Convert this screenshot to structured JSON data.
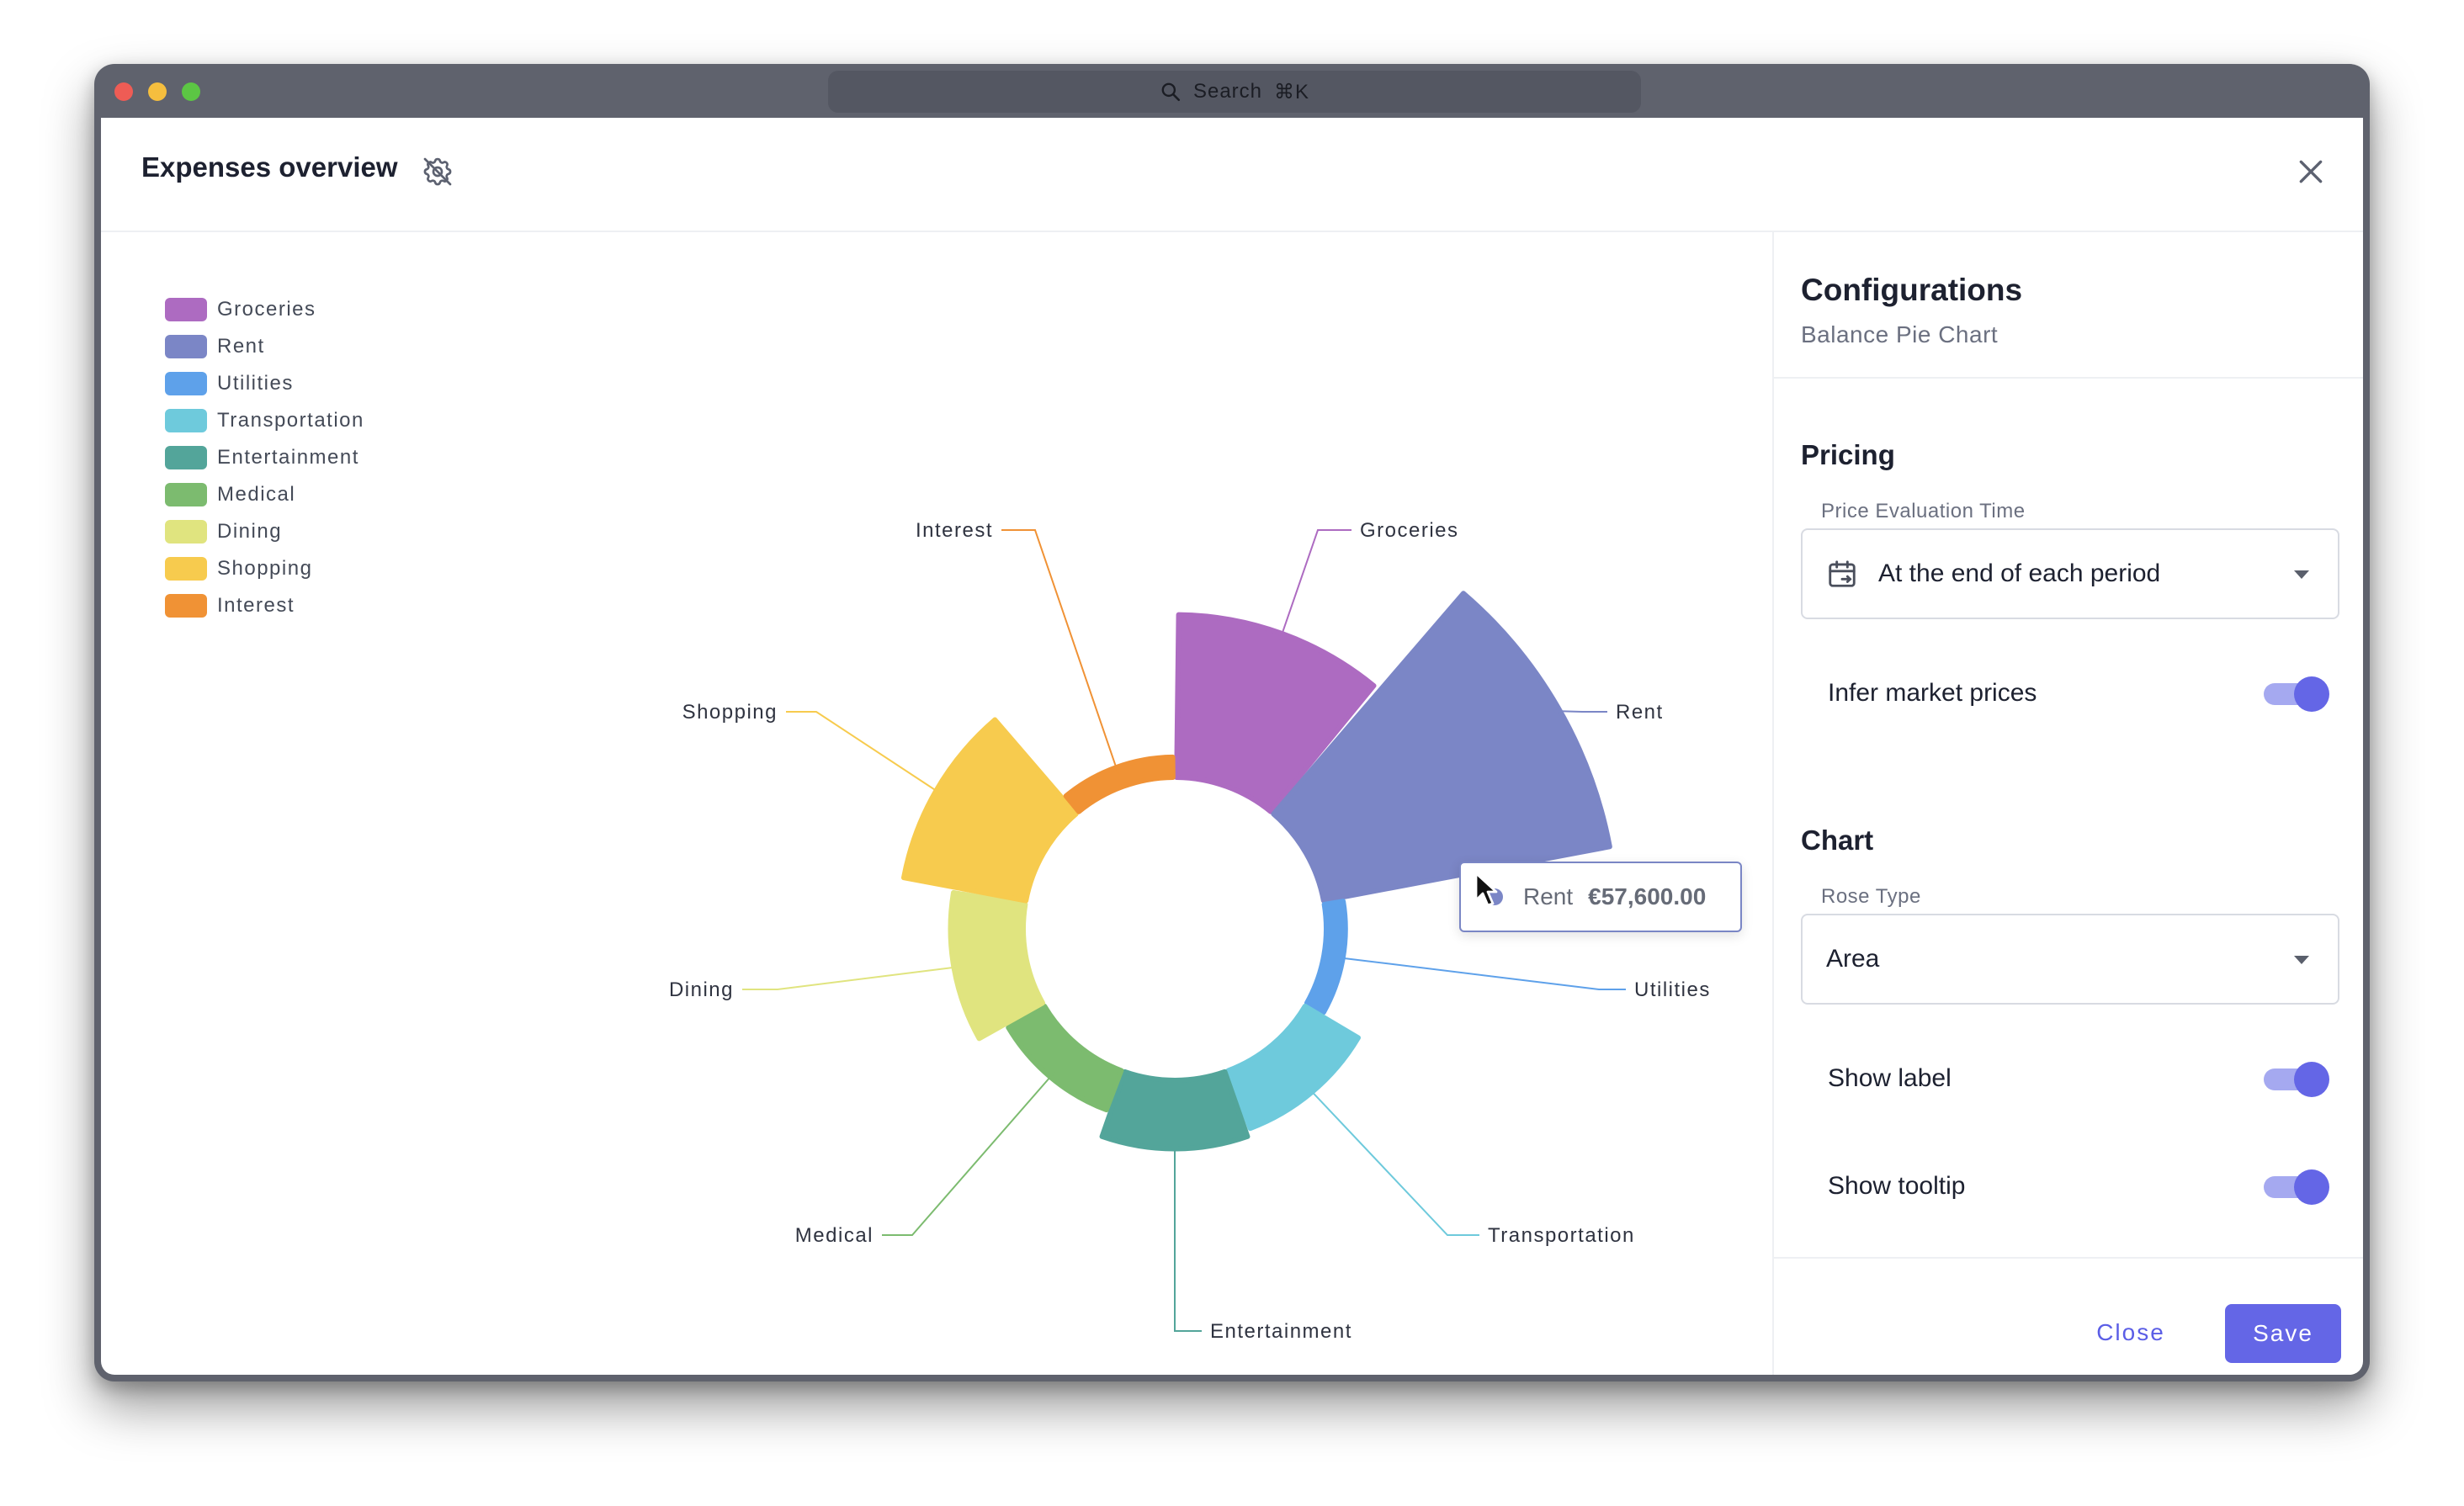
{
  "window": {
    "search_placeholder": "Search",
    "search_shortcut": "⌘K"
  },
  "modal": {
    "title": "Expenses overview"
  },
  "config": {
    "title": "Configurations",
    "subtitle": "Balance Pie Chart",
    "pricing": {
      "title": "Pricing",
      "price_eval_label": "Price Evaluation Time",
      "price_eval_value": "At the end of each period",
      "infer_label": "Infer market prices",
      "infer_on": true
    },
    "chart": {
      "title": "Chart",
      "rose_label": "Rose Type",
      "rose_value": "Area",
      "show_label": "Show label",
      "show_label_on": true,
      "show_tooltip": "Show tooltip",
      "show_tooltip_on": true
    },
    "close_label": "Close",
    "save_label": "Save"
  },
  "tooltip": {
    "name": "Rent",
    "value": "€57,600.00",
    "color": "#7b86c6"
  },
  "chart_data": {
    "type": "pie",
    "rose_type": "area",
    "legend_position": "top-left",
    "series": [
      {
        "name": "Groceries",
        "value": 18000,
        "color": "#ad6bc1"
      },
      {
        "name": "Rent",
        "value": 57600,
        "color": "#7b86c6"
      },
      {
        "name": "Utilities",
        "value": 250,
        "color": "#5ea1ea"
      },
      {
        "name": "Transportation",
        "value": 2600,
        "color": "#6ecadc"
      },
      {
        "name": "Entertainment",
        "value": 3200,
        "color": "#53a59a"
      },
      {
        "name": "Medical",
        "value": 1200,
        "color": "#7cbb6f"
      },
      {
        "name": "Dining",
        "value": 3600,
        "color": "#e0e47f"
      },
      {
        "name": "Shopping",
        "value": 10500,
        "color": "#f7cb4e"
      },
      {
        "name": "Interest",
        "value": 280,
        "color": "#f09235"
      }
    ]
  }
}
